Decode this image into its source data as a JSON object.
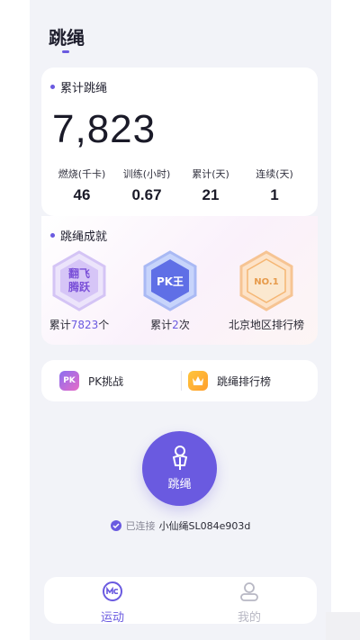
{
  "header": {
    "title": "跳绳"
  },
  "total": {
    "section_title": "累计跳绳",
    "count": "7,823",
    "stats": [
      {
        "label": "燃烧(千卡)",
        "value": "46"
      },
      {
        "label": "训练(小时)",
        "value": "0.67"
      },
      {
        "label": "累计(天)",
        "value": "21"
      },
      {
        "label": "连续(天)",
        "value": "1"
      }
    ]
  },
  "achievements": {
    "section_title": "跳绳成就",
    "badges": [
      {
        "name": "翻飞腾跃",
        "line1": "翻飞",
        "line2": "腾跃",
        "label_prefix": "累计",
        "label_value": "7823",
        "label_suffix": "个"
      },
      {
        "name": "PK王",
        "text": "PK王",
        "label_prefix": "累计",
        "label_value": "2",
        "label_suffix": "次"
      },
      {
        "name": "NO.1",
        "text": "NO.1",
        "label": "北京地区排行榜"
      }
    ]
  },
  "actions": {
    "pk": {
      "label": "PK挑战",
      "icon_text": "PK"
    },
    "ranking": {
      "label": "跳绳排行榜"
    }
  },
  "jump_button": {
    "label": "跳绳"
  },
  "connection": {
    "status": "已连接",
    "device": "小仙绳SL084e903d"
  },
  "tabbar": {
    "items": [
      {
        "label": "运动",
        "active": true,
        "icon": "sport-logo-icon"
      },
      {
        "label": "我的",
        "active": false,
        "icon": "user-icon"
      }
    ]
  },
  "colors": {
    "accent": "#6a5ae0",
    "background": "#f2f3f8"
  }
}
